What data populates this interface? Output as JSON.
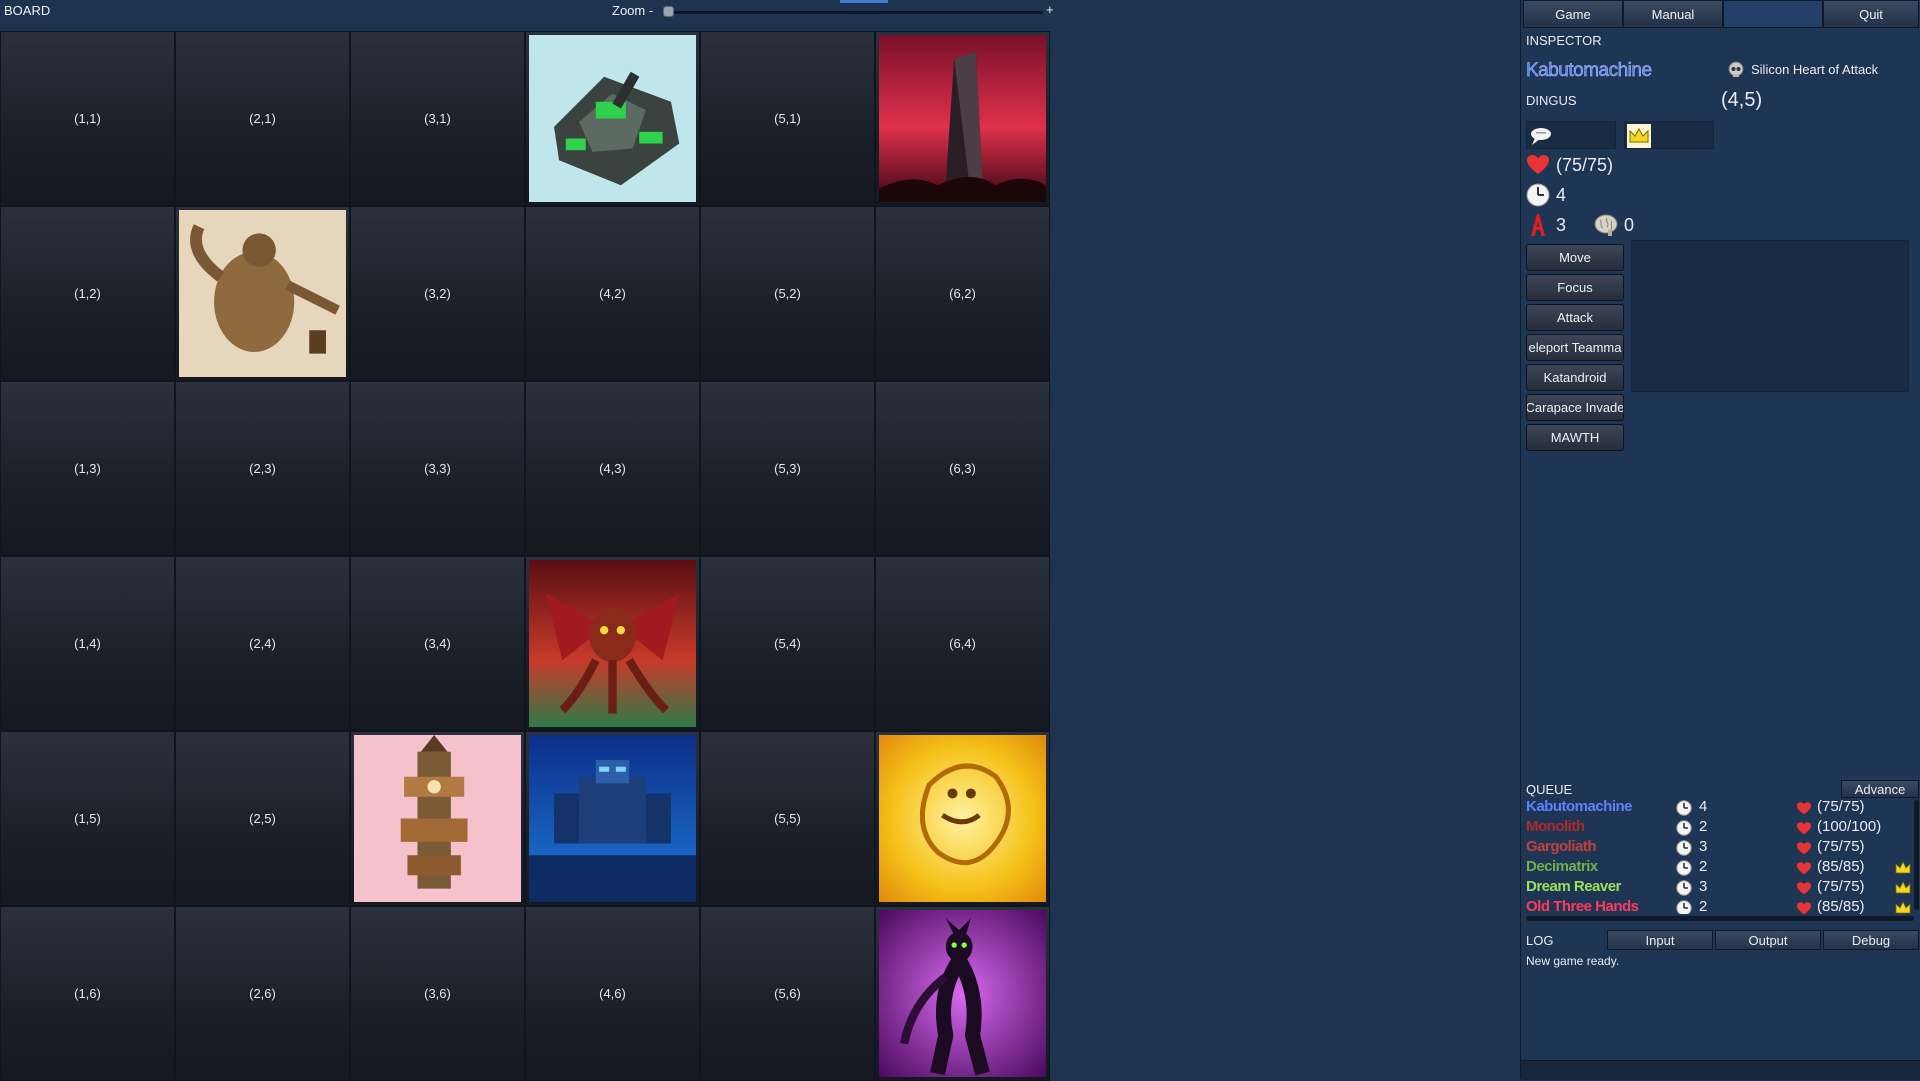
{
  "board": {
    "title": "BOARD",
    "zoom_label": "Zoom -",
    "zoom_plus": "+",
    "cells": [
      {
        "label": "(1,1)"
      },
      {
        "label": "(2,1)"
      },
      {
        "label": "(3,1)"
      },
      {
        "art": "tank"
      },
      {
        "label": "(5,1)"
      },
      {
        "art": "monolith"
      },
      {
        "label": "(1,2)"
      },
      {
        "art": "giant"
      },
      {
        "label": "(3,2)"
      },
      {
        "label": "(4,2)"
      },
      {
        "label": "(5,2)"
      },
      {
        "label": "(6,2)"
      },
      {
        "label": "(1,3)"
      },
      {
        "label": "(2,3)"
      },
      {
        "label": "(3,3)"
      },
      {
        "label": "(4,3)"
      },
      {
        "label": "(5,3)"
      },
      {
        "label": "(6,3)"
      },
      {
        "label": "(1,4)"
      },
      {
        "label": "(2,4)"
      },
      {
        "label": "(3,4)"
      },
      {
        "art": "demon"
      },
      {
        "label": "(5,4)"
      },
      {
        "label": "(6,4)"
      },
      {
        "label": "(1,5)"
      },
      {
        "label": "(2,5)"
      },
      {
        "art": "tower"
      },
      {
        "art": "robot"
      },
      {
        "label": "(5,5)"
      },
      {
        "art": "fire"
      },
      {
        "label": "(1,6)"
      },
      {
        "label": "(2,6)"
      },
      {
        "label": "(3,6)"
      },
      {
        "label": "(4,6)"
      },
      {
        "label": "(5,6)"
      },
      {
        "art": "purple"
      }
    ]
  },
  "tabs": {
    "game": "Game",
    "manual": "Manual",
    "blank": "",
    "quit": "Quit"
  },
  "inspector": {
    "title": "INSPECTOR",
    "unit_name": "Kabutomachine",
    "unit_class": "DINGUS",
    "position": "(4,5)",
    "item_icon": "skull-icon",
    "item_name": "Silicon Heart of Attack",
    "hp": "(75/75)",
    "initiative": "4",
    "attack": "3",
    "focus": "0",
    "actions": [
      "Move",
      "Focus",
      "Attack",
      "eleport Teamma",
      "Katandroid",
      "Carapace Invade",
      "MAWTH"
    ]
  },
  "queue": {
    "title": "QUEUE",
    "advance": "Advance",
    "rows": [
      {
        "name": "Kabutomachine",
        "color": "#5a82ff",
        "time": "4",
        "hp": "(75/75)",
        "crown": false
      },
      {
        "name": "Monolith",
        "color": "#b12a2a",
        "time": "2",
        "hp": "(100/100)",
        "crown": false
      },
      {
        "name": "Gargoliath",
        "color": "#c2413b",
        "time": "3",
        "hp": "(75/75)",
        "crown": false
      },
      {
        "name": "Decimatrix",
        "color": "#6fb04a",
        "time": "2",
        "hp": "(85/85)",
        "crown": true
      },
      {
        "name": "Dream Reaver",
        "color": "#9be05a",
        "time": "3",
        "hp": "(75/75)",
        "crown": true
      },
      {
        "name": "Old Three Hands",
        "color": "#ff3a5a",
        "time": "2",
        "hp": "(85/85)",
        "crown": true
      }
    ]
  },
  "log": {
    "title": "LOG",
    "tabs": [
      "Input",
      "Output",
      "Debug"
    ],
    "message": "New game ready."
  },
  "colors": {
    "heart": "#e83434",
    "crown": "#f2d81f",
    "attack": "#e02020"
  }
}
